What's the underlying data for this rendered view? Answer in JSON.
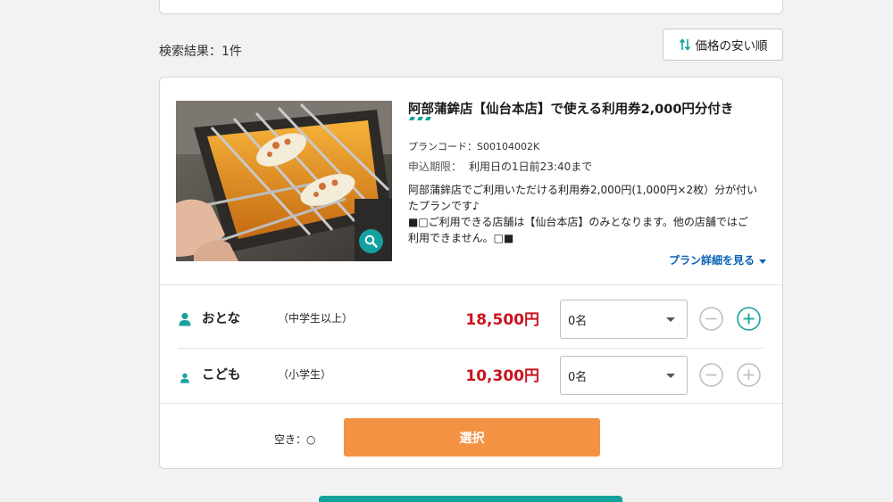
{
  "search": {
    "results_count": "検索結果：1件",
    "sort_label": "価格の安い順"
  },
  "plan": {
    "title": "阿部蒲鉾店【仙台本店】で使える利用券2,000円分付き",
    "code": "プランコード：S00104002K",
    "deadline_label": "申込期限：",
    "deadline_value": "利用日の1日前23:40まで",
    "description_lines": [
      "阿部蒲鉾店でご利用いただける利用券2,000円(1,000円×2枚）分が付い",
      "たプランです♪",
      "■□ご利用できる店舗は【仙台本店】のみとなります。他の店舗ではご",
      "利用できません。□■"
    ],
    "details_link": "プラン詳細を見る",
    "accent_color": "#16a19d"
  },
  "tickets": [
    {
      "label": "おとな",
      "age": "（中学生以上）",
      "price": "18,500円",
      "quantity": "0名"
    },
    {
      "label": "こども",
      "age": "（小学生）",
      "price": "10,300円",
      "quantity": "0名"
    }
  ],
  "footer": {
    "availability": "空き：○",
    "select_label": "選択",
    "select_color": "#f39243"
  }
}
